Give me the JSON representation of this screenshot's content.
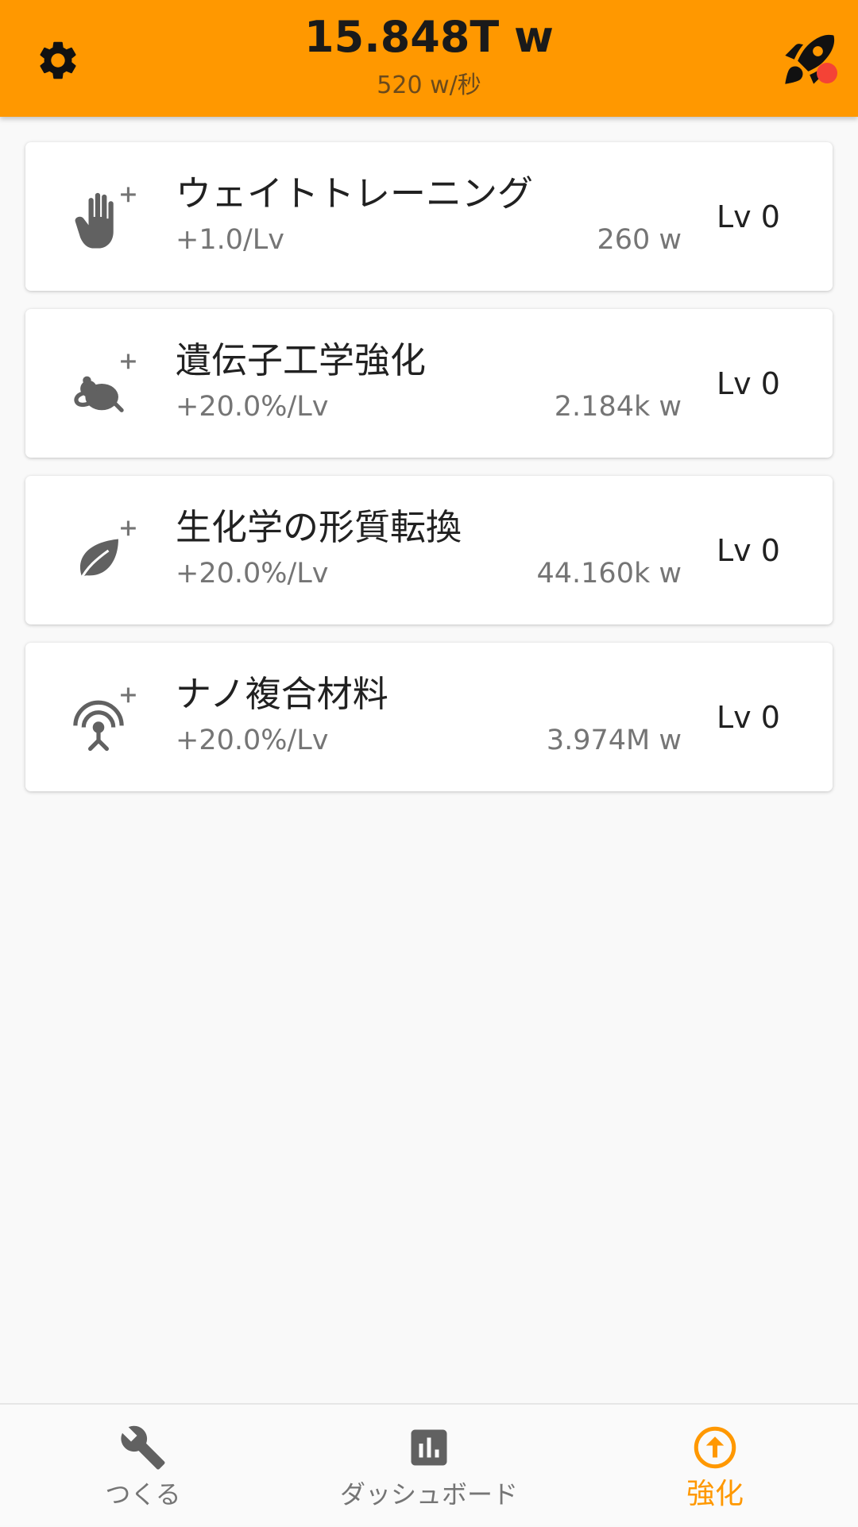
{
  "header": {
    "total": "15.848T w",
    "rate": "520 w/秒",
    "settings_icon": "gear-icon",
    "rocket_icon": "rocket-icon",
    "bg_color": "#ff9800",
    "notify_color": "#f44336"
  },
  "upgrades": [
    {
      "icon": "hand-plus-icon",
      "title": "ウェイトトレーニング",
      "effect": "+1.0/Lv",
      "cost": "260 w",
      "level": "Lv 0"
    },
    {
      "icon": "mouse-plus-icon",
      "title": "遺伝子工学強化",
      "effect": "+20.0%/Lv",
      "cost": "2.184k w",
      "level": "Lv 0"
    },
    {
      "icon": "leaf-plus-icon",
      "title": "生化学の形質転換",
      "effect": "+20.0%/Lv",
      "cost": "44.160k w",
      "level": "Lv 0"
    },
    {
      "icon": "antenna-plus-icon",
      "title": "ナノ複合材料",
      "effect": "+20.0%/Lv",
      "cost": "3.974M w",
      "level": "Lv 0"
    }
  ],
  "nav": {
    "items": [
      {
        "label": "つくる",
        "icon": "wrench-icon"
      },
      {
        "label": "ダッシュボード",
        "icon": "bar-chart-icon"
      },
      {
        "label": "強化",
        "icon": "upgrade-arrow-icon"
      }
    ],
    "active_color": "#ff9800"
  }
}
